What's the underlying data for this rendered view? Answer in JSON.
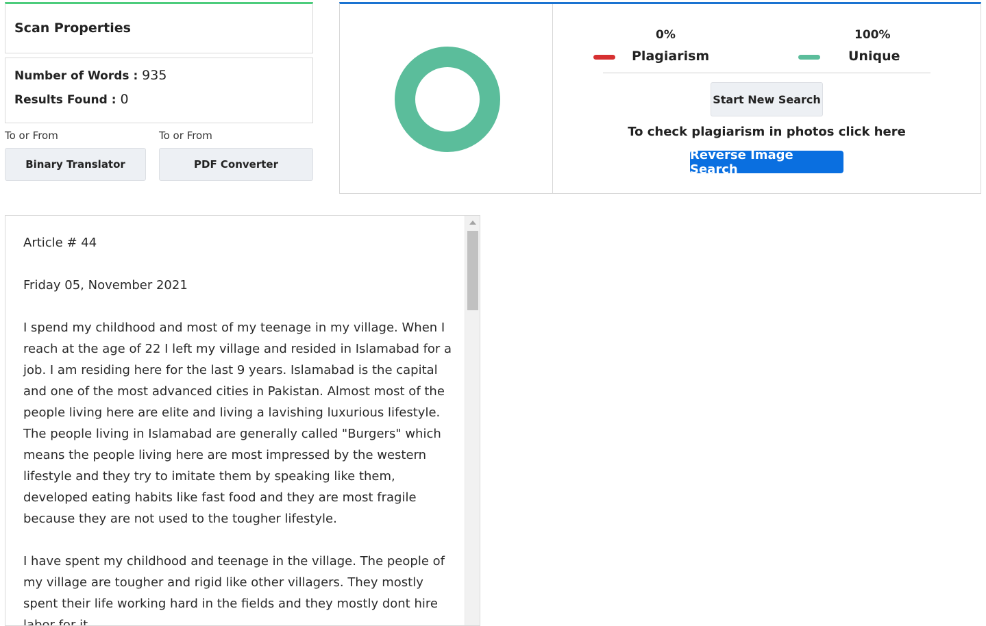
{
  "scan": {
    "title": "Scan Properties",
    "words_label": "Number of Words : ",
    "words_value": "935",
    "results_label": "Results Found : ",
    "results_value": "0"
  },
  "tools": [
    {
      "caption": "To or From",
      "label": "Binary Translator"
    },
    {
      "caption": "To or From",
      "label": "PDF Converter"
    }
  ],
  "results": {
    "plagiarism_pct": "0%",
    "plagiarism_label": "Plagiarism",
    "unique_pct": "100%",
    "unique_label": "Unique",
    "new_search_label": "Start New Search",
    "photo_text": "To check plagiarism in photos click here",
    "reverse_label": "Reverse Image Search"
  },
  "colors": {
    "plagiarism": "#d63031",
    "unique": "#5bbd9b",
    "accent_blue": "#0a6fe0",
    "accent_green": "#4ccc7c"
  },
  "chart_data": {
    "type": "pie",
    "categories": [
      "Plagiarism",
      "Unique"
    ],
    "values": [
      0,
      100
    ]
  },
  "article": {
    "paragraphs": [
      "Article # 44",
      "Friday 05, November 2021",
      "I spend my childhood and most of my teenage in my village. When I reach at the age of 22 I left my village and resided in Islamabad for a job. I am residing here for the last 9 years. Islamabad is the capital and one of the most advanced cities in Pakistan. Almost most of the people living here are elite and living a lavishing luxurious lifestyle. The people living in Islamabad are generally called \"Burgers\" which means the people living here are most impressed by the western lifestyle and they try to imitate them by speaking like them, developed eating habits like fast food and they are most fragile because they are not used to the tougher lifestyle.",
      "I have spent my childhood and teenage in the village. The people of my village are tougher and rigid like other villagers. They mostly spent their life working hard in the fields and they mostly dont hire labor for it"
    ]
  }
}
